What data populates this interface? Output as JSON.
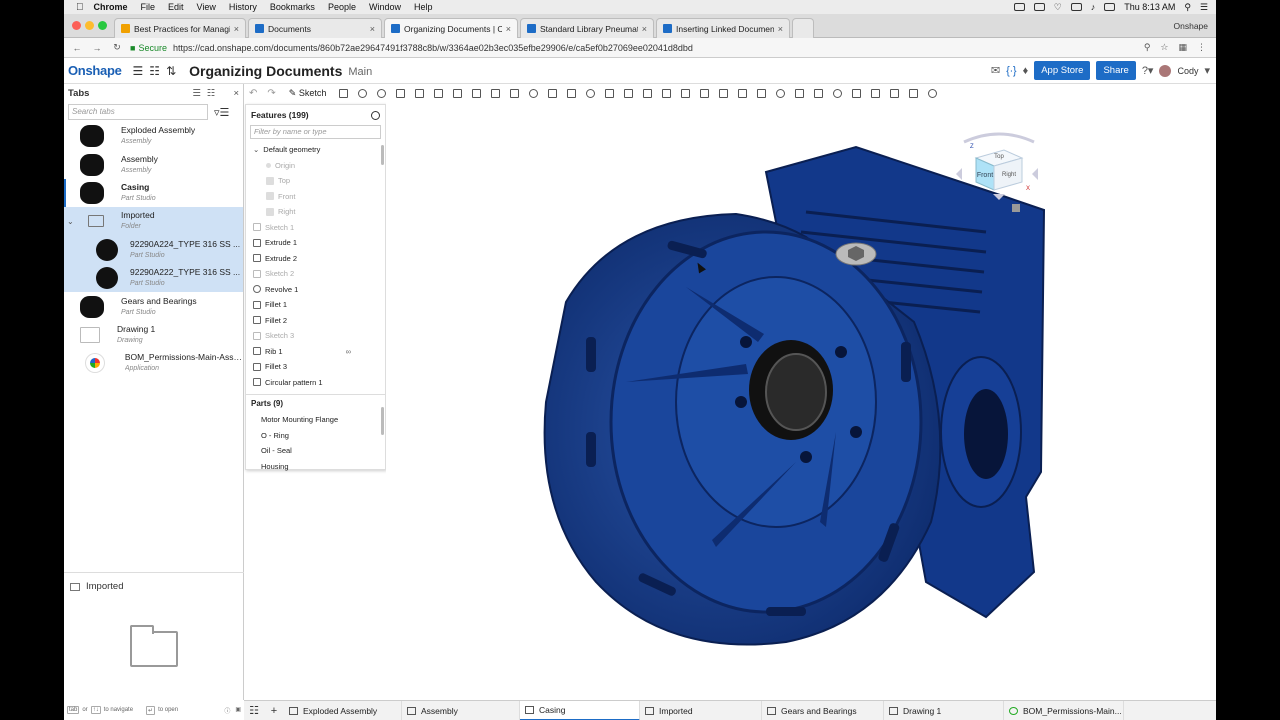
{
  "menubar": {
    "items": [
      "Chrome",
      "File",
      "Edit",
      "View",
      "History",
      "Bookmarks",
      "People",
      "Window",
      "Help"
    ],
    "clock": "Thu 8:13 AM"
  },
  "browser": {
    "tabs": [
      {
        "label": "Best Practices for Managing D",
        "color": "#f0a000"
      },
      {
        "label": "Documents",
        "color": "#1d6cc6"
      },
      {
        "label": "Organizing Documents | Casin",
        "color": "#1d6cc6"
      },
      {
        "label": "Standard Library Pneumatic Cy",
        "color": "#1d6cc6"
      },
      {
        "label": "Inserting Linked Documents | ",
        "color": "#1d6cc6"
      }
    ],
    "profile": "Onshape",
    "secure_label": "Secure",
    "url": "https://cad.onshape.com/documents/860b72ae29647491f3788c8b/w/3364ae02b3ec035efbe29906/e/ca5ef0b27069ee02041d8dbd"
  },
  "app": {
    "logo": "Onshape",
    "doc_title": "Organizing Documents",
    "workspace": "Main",
    "app_store": "App Store",
    "share": "Share",
    "user": "Cody",
    "accent": "#1d6cc6"
  },
  "tabs_panel": {
    "title": "Tabs",
    "search_placeholder": "Search tabs",
    "items": [
      {
        "name": "Exploded Assembly",
        "type": "Assembly"
      },
      {
        "name": "Assembly",
        "type": "Assembly"
      },
      {
        "name": "Casing",
        "type": "Part Studio"
      },
      {
        "name": "Imported",
        "type": "Folder"
      },
      {
        "name": "92290A224_TYPE 316 SS ...",
        "type": "Part Studio"
      },
      {
        "name": "92290A222_TYPE 316 SS ...",
        "type": "Part Studio"
      },
      {
        "name": "Gears and Bearings",
        "type": "Part Studio"
      },
      {
        "name": "Drawing 1",
        "type": "Drawing"
      },
      {
        "name": "BOM_Permissions-Main-Asse...",
        "type": "Application"
      }
    ],
    "preview_title": "Imported",
    "footer": {
      "tab_key": "tab",
      "or": "or",
      "nav": "to navigate",
      "open": "to open"
    }
  },
  "toolbar": {
    "sketch_label": "Sketch"
  },
  "feature_list": {
    "header": "Features (199)",
    "filter_placeholder": "Filter by name or type",
    "default_geometry": "Default geometry",
    "geometry_items": [
      "Origin",
      "Top",
      "Front",
      "Right"
    ],
    "features": [
      "Sketch 1",
      "Extrude 1",
      "Extrude 2",
      "Sketch 2",
      "Revolve 1",
      "Fillet 1",
      "Fillet 2",
      "Sketch 3",
      "Rib 1",
      "Fillet 3",
      "Circular pattern 1"
    ],
    "parts_header": "Parts (9)",
    "parts": [
      "Motor Mounting Flange",
      "O - Ring",
      "Oil - Seal",
      "Housing"
    ]
  },
  "viewcube": {
    "front": "Front",
    "top": "Top",
    "right": "Right"
  },
  "bottom_tabs": [
    "Exploded Assembly",
    "Assembly",
    "Casing",
    "Imported",
    "Gears and Bearings",
    "Drawing 1",
    "BOM_Permissions-Main..."
  ]
}
